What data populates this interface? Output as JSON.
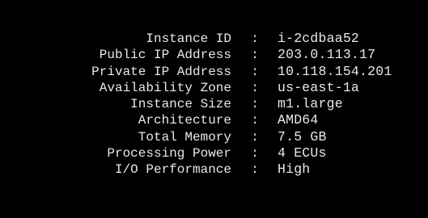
{
  "instance_info": {
    "rows": [
      {
        "label": "Instance ID",
        "separator": ":",
        "value": "i-2cdbaa52"
      },
      {
        "label": "Public IP Address",
        "separator": ":",
        "value": "203.0.113.17"
      },
      {
        "label": "Private IP Address",
        "separator": ":",
        "value": "10.118.154.201"
      },
      {
        "label": "Availability Zone",
        "separator": ":",
        "value": "us-east-1a"
      },
      {
        "label": "Instance Size",
        "separator": ":",
        "value": "m1.large"
      },
      {
        "label": "Architecture",
        "separator": ":",
        "value": "AMD64"
      },
      {
        "label": "Total Memory",
        "separator": ":",
        "value": "7.5 GB"
      },
      {
        "label": "Processing Power",
        "separator": ":",
        "value": "4 ECUs"
      },
      {
        "label": "I/O Performance",
        "separator": ":",
        "value": "High"
      }
    ]
  },
  "colors": {
    "background": "#000000",
    "text": "#e8e8e8"
  }
}
